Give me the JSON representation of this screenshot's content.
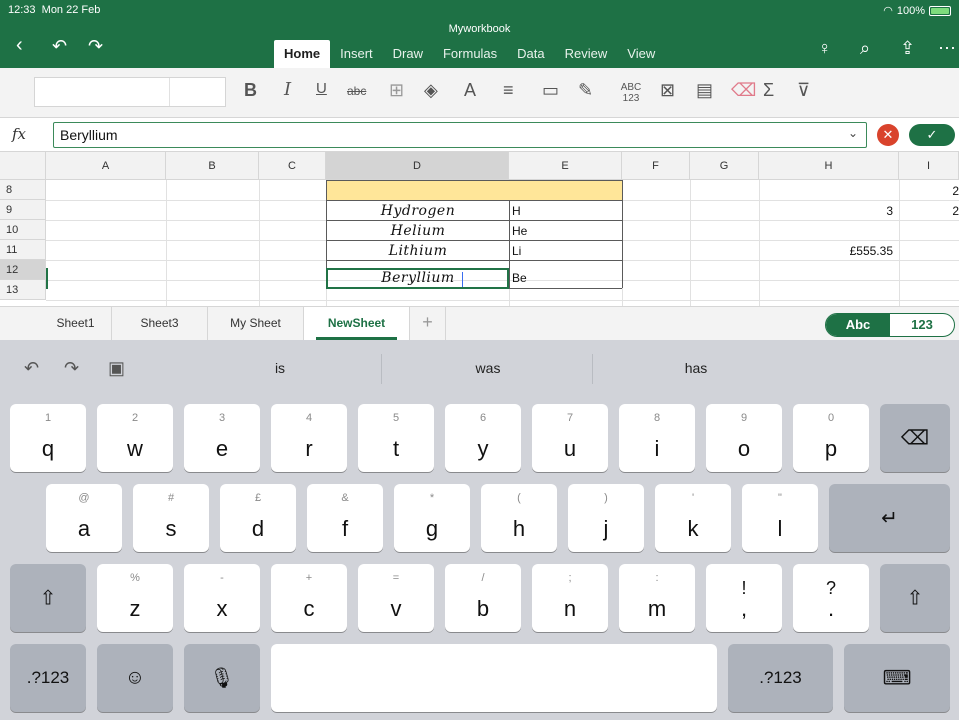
{
  "status": {
    "time": "12:33",
    "date": "Mon 22 Feb",
    "battery": "100%"
  },
  "workbook_title": "Myworkbook",
  "ribbon_tabs": [
    "Home",
    "Insert",
    "Draw",
    "Formulas",
    "Data",
    "Review",
    "View"
  ],
  "toolbar": {
    "bold": "B",
    "italic": "I",
    "underline": "U",
    "strike": "abc",
    "sum": "Σ",
    "spell": "ABC 123"
  },
  "formula_bar": {
    "fx": "fx",
    "value": "Beryllium"
  },
  "columns": [
    "A",
    "B",
    "C",
    "D",
    "E",
    "F",
    "G",
    "H",
    "I"
  ],
  "rows": [
    "8",
    "9",
    "10",
    "11",
    "12",
    "13"
  ],
  "cells": {
    "d9": "Hydrogen",
    "e9": "H",
    "d10": "Helium",
    "e10": "He",
    "d11": "Lithium",
    "e11": "Li",
    "d12": "Beryllium",
    "e12": "Be",
    "h9": "3",
    "h11": "£555.35",
    "i8": "2",
    "i9": "2"
  },
  "sheet_tabs": [
    "Sheet1",
    "Sheet3",
    "My Sheet",
    "NewSheet"
  ],
  "add_sheet": "+",
  "keyboard_toggle": {
    "abc": "Abc",
    "num": "123"
  },
  "suggestions": [
    "is",
    "was",
    "has"
  ],
  "keyboard": {
    "row1": [
      {
        "sub": "1",
        "main": "q"
      },
      {
        "sub": "2",
        "main": "w"
      },
      {
        "sub": "3",
        "main": "e"
      },
      {
        "sub": "4",
        "main": "r"
      },
      {
        "sub": "5",
        "main": "t"
      },
      {
        "sub": "6",
        "main": "y"
      },
      {
        "sub": "7",
        "main": "u"
      },
      {
        "sub": "8",
        "main": "i"
      },
      {
        "sub": "9",
        "main": "o"
      },
      {
        "sub": "0",
        "main": "p"
      }
    ],
    "row2": [
      {
        "sub": "@",
        "main": "a"
      },
      {
        "sub": "#",
        "main": "s"
      },
      {
        "sub": "£",
        "main": "d"
      },
      {
        "sub": "&",
        "main": "f"
      },
      {
        "sub": "*",
        "main": "g"
      },
      {
        "sub": "(",
        "main": "h"
      },
      {
        "sub": ")",
        "main": "j"
      },
      {
        "sub": "'",
        "main": "k"
      },
      {
        "sub": "\"",
        "main": "l"
      }
    ],
    "row3": [
      {
        "sub": "%",
        "main": "z"
      },
      {
        "sub": "-",
        "main": "x"
      },
      {
        "sub": "+",
        "main": "c"
      },
      {
        "sub": "=",
        "main": "v"
      },
      {
        "sub": "/",
        "main": "b"
      },
      {
        "sub": ";",
        "main": "n"
      },
      {
        "sub": ":",
        "main": "m"
      },
      {
        "sub": "!",
        "main": ","
      },
      {
        "sub": "?",
        "main": "."
      }
    ],
    "numbers_label": ".?123"
  }
}
